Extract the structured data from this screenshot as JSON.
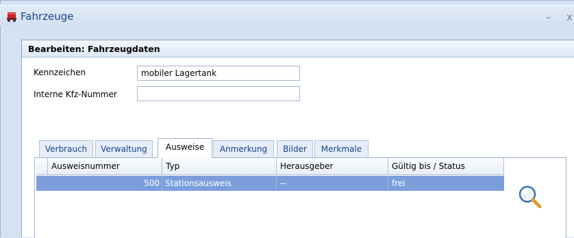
{
  "window": {
    "title": "Fahrzeuge",
    "minimize": "–",
    "close": "x",
    "icon": "truck-icon"
  },
  "panel": {
    "title": "Bearbeiten: Fahrzeugdaten"
  },
  "fields": {
    "kennzeichen_label": "Kennzeichen",
    "kennzeichen_value": "mobiler Lagertank",
    "kfz_label": "Interne Kfz-Nummer",
    "kfz_value": ""
  },
  "tabs": [
    {
      "label": "Verbrauch"
    },
    {
      "label": "Verwaltung"
    },
    {
      "label": "Ausweise",
      "active": true
    },
    {
      "label": "Anmerkung"
    },
    {
      "label": "Bilder"
    },
    {
      "label": "Merkmale"
    }
  ],
  "grid": {
    "columns": [
      "Ausweisnummer",
      "Typ",
      "Herausgeber",
      "Gültig bis / Status"
    ],
    "rows": [
      {
        "indicator": ">",
        "cells": [
          "500",
          "Stationsausweis",
          "--",
          "frei"
        ]
      }
    ],
    "selection_color": "#7c9fdc"
  },
  "search_button": {
    "icon": "magnifier-icon"
  }
}
